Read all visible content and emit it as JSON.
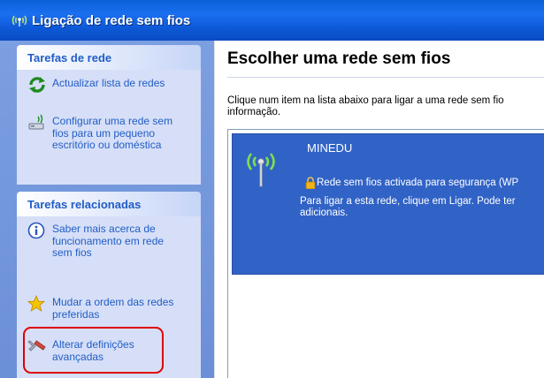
{
  "window": {
    "title": "Ligação de rede sem fios"
  },
  "sidebar": {
    "network_tasks": {
      "header": "Tarefas de rede",
      "items": [
        {
          "label": "Actualizar lista de redes",
          "icon": "refresh-icon"
        },
        {
          "label": "Configurar uma rede sem fios para um pequeno escritório ou doméstica",
          "icon": "setup-network-icon"
        }
      ]
    },
    "related_tasks": {
      "header": "Tarefas relacionadas",
      "items": [
        {
          "label": "Saber mais acerca de funcionamento em rede sem fios",
          "icon": "info-icon"
        },
        {
          "label": "Mudar a ordem das redes preferidas",
          "icon": "star-icon"
        },
        {
          "label": "Alterar definições avançadas",
          "icon": "settings-tools-icon"
        }
      ]
    }
  },
  "main": {
    "title": "Escolher uma rede sem fios",
    "instructions": "Clique num item na lista abaixo para ligar a uma rede sem fio",
    "instructions_line2": "informação.",
    "networks": [
      {
        "ssid": "MINEDU",
        "security": "Rede sem fios activada para segurança (WP",
        "message_line1": "Para ligar a esta rede, clique em Ligar. Pode ter",
        "message_line2": "adicionais.",
        "selected": true
      }
    ]
  },
  "colors": {
    "titlebar": "#0a5fd8",
    "task_link": "#215dc6",
    "selected_item": "#3163c6",
    "highlight": "#e00000"
  }
}
